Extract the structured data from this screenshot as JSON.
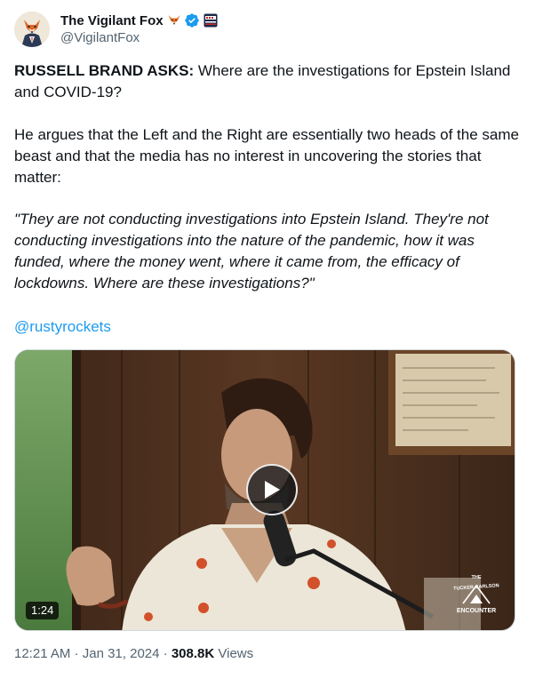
{
  "author": {
    "display_name": "The Vigilant Fox",
    "handle": "@VigilantFox",
    "verified_color": "#1d9bf0"
  },
  "tweet": {
    "lead_bold": "RUSSELL BRAND ASKS:",
    "lead_rest": " Where are the investigations for Epstein Island and COVID-19?",
    "paragraph_2": "He argues that the Left and the Right are essentially two heads of the same beast and that the media has no interest in uncovering the stories that matter:",
    "quote": "\"They are not conducting investigations into Epstein Island. They're not conducting investigations into the nature of the pandemic, how it was funded, where the money went, where it came from, the efficacy of lockdowns. Where are these investigations?\"",
    "mention": "@rustyrockets"
  },
  "video": {
    "duration": "1:24",
    "badge_text_top": "THE",
    "badge_text_arc": "TUCKER CARLSON",
    "badge_text_bottom": "ENCOUNTER"
  },
  "meta": {
    "time": "12:21 AM",
    "separator": "·",
    "date": "Jan 31, 2024",
    "views_count": "308.8K",
    "views_label": "Views"
  },
  "colors": {
    "text_primary": "#0f1419",
    "text_secondary": "#536471",
    "link": "#1d9bf0"
  }
}
